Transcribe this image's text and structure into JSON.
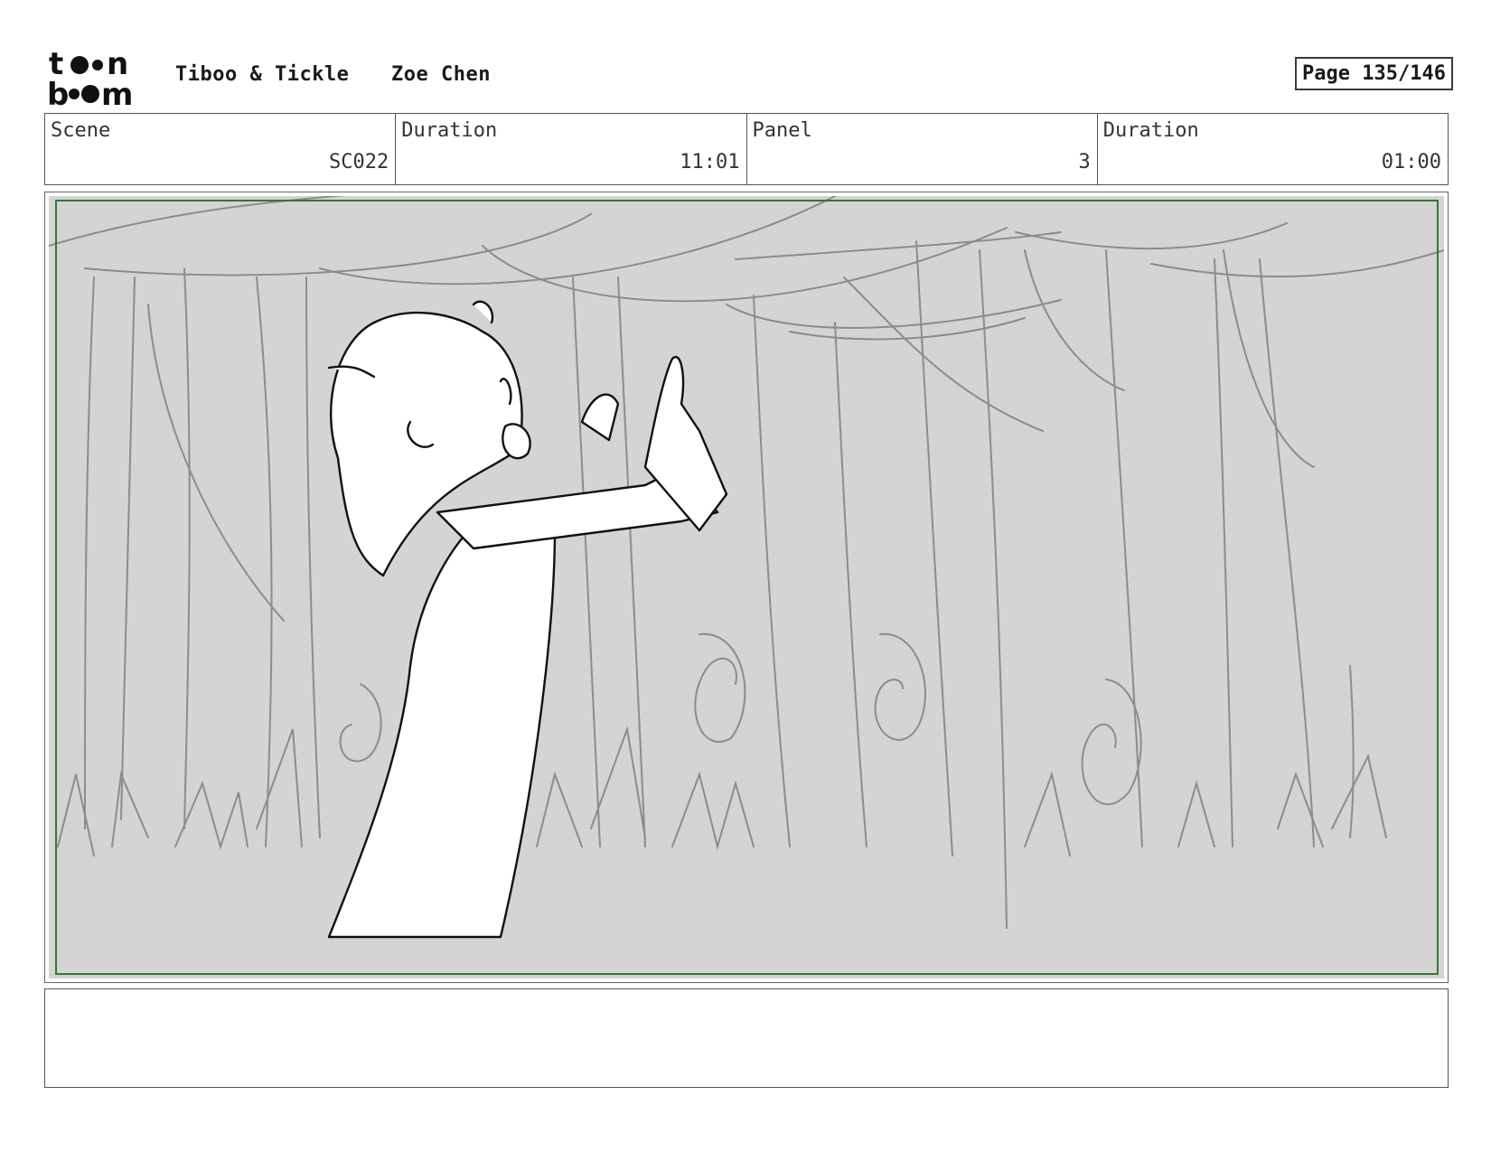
{
  "header": {
    "logo_text": "toon boom",
    "project": "Tiboo & Tickle",
    "author": "Zoe Chen",
    "page_label": "Page 135/146"
  },
  "info": {
    "scene_label": "Scene",
    "scene_value": "SC022",
    "scene_duration_label": "Duration",
    "scene_duration_value": "11:01",
    "panel_label": "Panel",
    "panel_value": "3",
    "panel_duration_label": "Duration",
    "panel_duration_value": "01:00"
  },
  "notes": {
    "text": ""
  },
  "colors": {
    "safe_frame": "#2f7a2f",
    "panel_background": "#d4d4d4",
    "sketch_lines": "#8c8c8c"
  }
}
